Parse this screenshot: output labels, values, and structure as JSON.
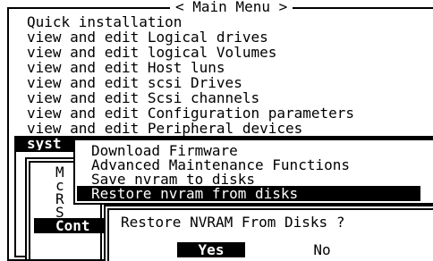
{
  "main_menu": {
    "title": "< Main Menu >",
    "items": [
      "Quick installation",
      "view and edit Logical drives",
      "view and edit logical Volumes",
      "view and edit Host luns",
      "view and edit scsi Drives",
      "view and edit Scsi channels",
      "view and edit Configuration parameters",
      "view and edit Peripheral devices",
      "syst"
    ],
    "partial_rows": [
      "v",
      "v"
    ]
  },
  "system_submenu": {
    "letters": [
      "M",
      "c",
      "R",
      "S"
    ],
    "selected": "Cont"
  },
  "firmware_submenu": {
    "items": [
      "Download Firmware",
      "Advanced Maintenance Functions",
      "Save nvram to disks",
      "Restore nvram from disks"
    ],
    "selected_index": 3
  },
  "dialog": {
    "question": "Restore NVRAM From Disks ?",
    "yes_label": "Yes",
    "no_label": "No"
  }
}
